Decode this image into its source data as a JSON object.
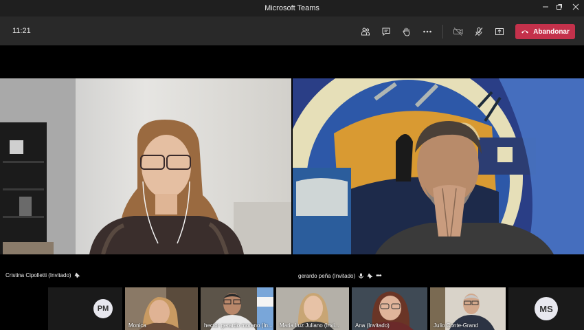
{
  "window": {
    "title": "Microsoft Teams"
  },
  "toolbar": {
    "time": "11:21",
    "leave_label": "Abandonar"
  },
  "participants": {
    "main_left": {
      "name": "Cristina Cipolletti (Invitado)"
    },
    "main_right": {
      "name": "gerardo peña (Invitado)"
    },
    "thumbs": [
      {
        "initials": "PM"
      },
      {
        "name": "Monica"
      },
      {
        "name": "hector gerardo moreno (In..."
      },
      {
        "name": "Maria Luz Juliano (Invi..."
      },
      {
        "name": "Ana (Invitado)"
      },
      {
        "name": "Julio Conte-Grand"
      },
      {
        "initials": "MS"
      }
    ]
  },
  "colors": {
    "leave": "#c4314b",
    "toolbar": "#292929",
    "titlebar": "#1f1f1f"
  }
}
